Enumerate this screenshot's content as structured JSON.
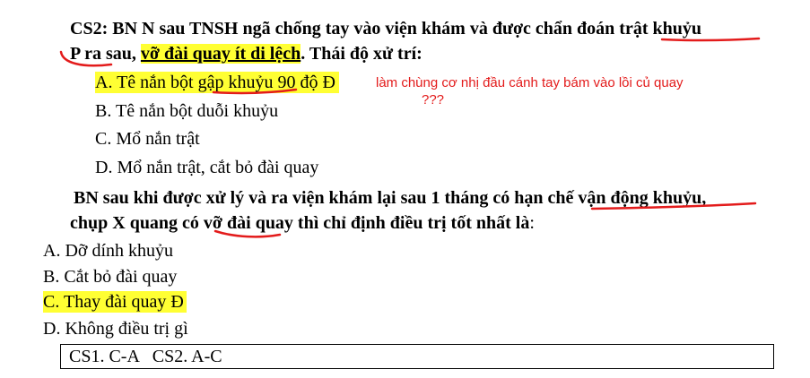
{
  "cs2": {
    "l1_a": "CS2: BN N sau TNSH ngã chống tay vào viện khám và được chẩn đoán ",
    "l1_b": "trật khuỷu",
    "l2_a": "P ra sau, ",
    "l2_b": "vỡ đài quay ít di lệch",
    "l2_c": ". Thái độ xử trí:",
    "opt_a": "A. Tê nắn bột gập khuỷu 90 độ Đ",
    "opt_b": "B. Tê nắn bột duỗi khuỷu",
    "opt_c": "C. Mổ nắn trật",
    "opt_d": "D. Mổ nắn trật, cắt bỏ đài quay",
    "note1": "làm chùng cơ nhị đầu cánh tay bám vào lồi củ quay",
    "note2": "???"
  },
  "q2": {
    "l1": "BN sau khi được xử lý và ra viện khám lại sau 1 tháng có hạn chế vận động khuỷu,",
    "l2_a": "chụp X quang có vỡ đài quay thì chỉ định điều trị tốt nhất là",
    "l2_b": ":",
    "opt_a": "A. Dỡ dính khuỷu",
    "opt_b": "B. Cắt bỏ đài quay",
    "opt_c": "C. Thay đài quay Đ",
    "opt_d": "D. Không điều trị gì"
  },
  "answer_key": "CS1. C-A   CS2. A-C",
  "colors": {
    "highlight": "#ffff33",
    "annotation": "#e31b1b"
  }
}
